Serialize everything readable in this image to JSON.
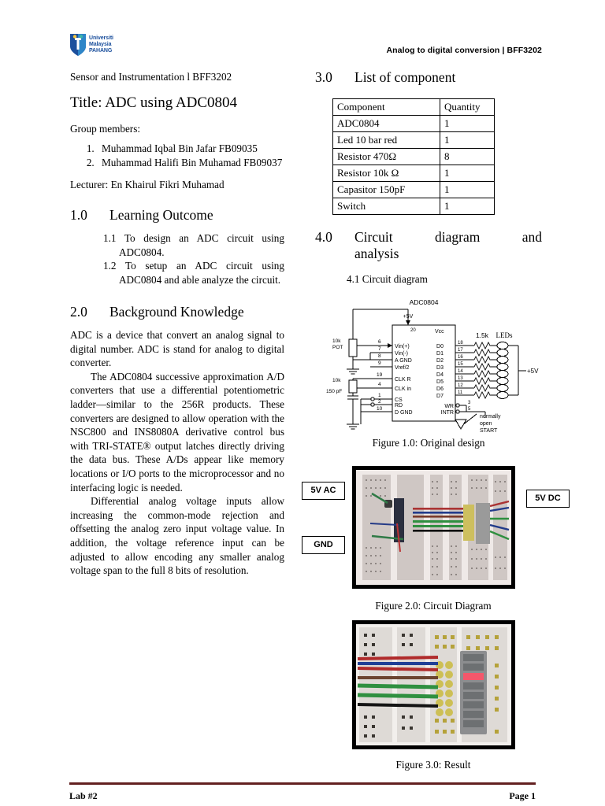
{
  "header": {
    "logo_alt": "universiti-malaysia-pahang-logo",
    "logo_line1": "Universiti",
    "logo_line2": "Malaysia",
    "logo_line3": "PAHANG",
    "right_text": "Analog to digital conversion | BFF3202"
  },
  "left": {
    "subject_line": "Sensor and Instrumentation l BFF3202",
    "doc_title": "Title: ADC using ADC0804",
    "group_label": "Group members:",
    "members": [
      "Muhammad Iqbal Bin Jafar FB09035",
      "Muhammad Halifi Bin Muhamad FB09037"
    ],
    "lecturer": "Lecturer: En Khairul Fikri Muhamad",
    "section1": {
      "num": "1.0",
      "title": "Learning Outcome",
      "items": [
        "1.1 To design an ADC circuit using ADC0804.",
        "1.2 To setup an ADC circuit using ADC0804 and able analyze the circuit."
      ]
    },
    "section2": {
      "num": "2.0",
      "title": "Background Knowledge",
      "para1": "ADC is a device that convert an analog signal to digital number. ADC is stand for analog to digital converter.",
      "para2": "The ADC0804 successive approximation A/D converters that use a differential potentiometric ladder—similar to the 256R products. These converters are designed to allow operation with the NSC800 and INS8080A derivative control bus with TRI-STATE® output latches directly driving the data bus. These A/Ds appear like memory locations or I/O ports to the microprocessor and no interfacing logic is needed.",
      "para3": "Differential analog voltage inputs allow increasing the common-mode rejection and offsetting the analog zero input voltage value. In addition, the voltage reference input can be adjusted to allow encoding any smaller analog voltage span to the full 8 bits of resolution."
    }
  },
  "right": {
    "section3": {
      "num": "3.0",
      "title": "List of component"
    },
    "table": {
      "headers": [
        "Component",
        "Quantity"
      ],
      "rows": [
        [
          "ADC0804",
          "1"
        ],
        [
          "Led 10 bar red",
          "1"
        ],
        [
          "Resistor 470Ω",
          "8"
        ],
        [
          "Resistor 10k Ω",
          "1"
        ],
        [
          "Capasitor 150pF",
          "1"
        ],
        [
          "Switch",
          "1"
        ]
      ]
    },
    "section4": {
      "num": "4.0",
      "title_line1": "Circuit diagram and",
      "title_line2": "analysis",
      "subheading": "4.1 Circuit diagram"
    },
    "figures": [
      {
        "caption": "Figure 1.0: Original design"
      },
      {
        "caption": "Figure 2.0: Circuit Diagram"
      },
      {
        "caption": "Figure 3.0: Result"
      }
    ],
    "callouts": {
      "ac": "5V AC",
      "gnd": "GND",
      "dc": "5V DC"
    },
    "circuit": {
      "chip_title": "ADC0804",
      "vcc_label": "+5V",
      "pin20": "20",
      "vcc_pin_name": "Vcc",
      "pot_label_1": "10k",
      "pot_label_2": "POT",
      "rc_label_1": "10k",
      "rc_label_2": "150 pF",
      "left_pins": [
        {
          "num": "6",
          "name": "Vin(+)"
        },
        {
          "num": "7",
          "name": "Vin(-)"
        },
        {
          "num": "8",
          "name": "A GND"
        },
        {
          "num": "9",
          "name": "Vref/2"
        },
        {
          "num": "19",
          "name": "CLK R"
        },
        {
          "num": "4",
          "name": "CLK in"
        },
        {
          "num": "1",
          "name": "CS"
        },
        {
          "num": "2",
          "name": "RD"
        },
        {
          "num": "10",
          "name": "D GND"
        }
      ],
      "data_pins": [
        {
          "name": "D0",
          "num": "18"
        },
        {
          "name": "D1",
          "num": "17"
        },
        {
          "name": "D2",
          "num": "16"
        },
        {
          "name": "D3",
          "num": "15"
        },
        {
          "name": "D4",
          "num": "14"
        },
        {
          "name": "D5",
          "num": "13"
        },
        {
          "name": "D6",
          "num": "12"
        },
        {
          "name": "D7",
          "num": "11"
        }
      ],
      "resistor_label": "1.5k",
      "leds_label": "LEDs",
      "supply_right": "+5V",
      "wr_pin": {
        "name": "WR",
        "num": "3"
      },
      "intr_pin": {
        "name": "INTR",
        "num": "5"
      },
      "switch_label_1": "normally",
      "switch_label_2": "open",
      "switch_label_3": "START"
    }
  },
  "footer": {
    "left": "Lab #2",
    "right": "Page 1",
    "rule_color": "#632020"
  }
}
